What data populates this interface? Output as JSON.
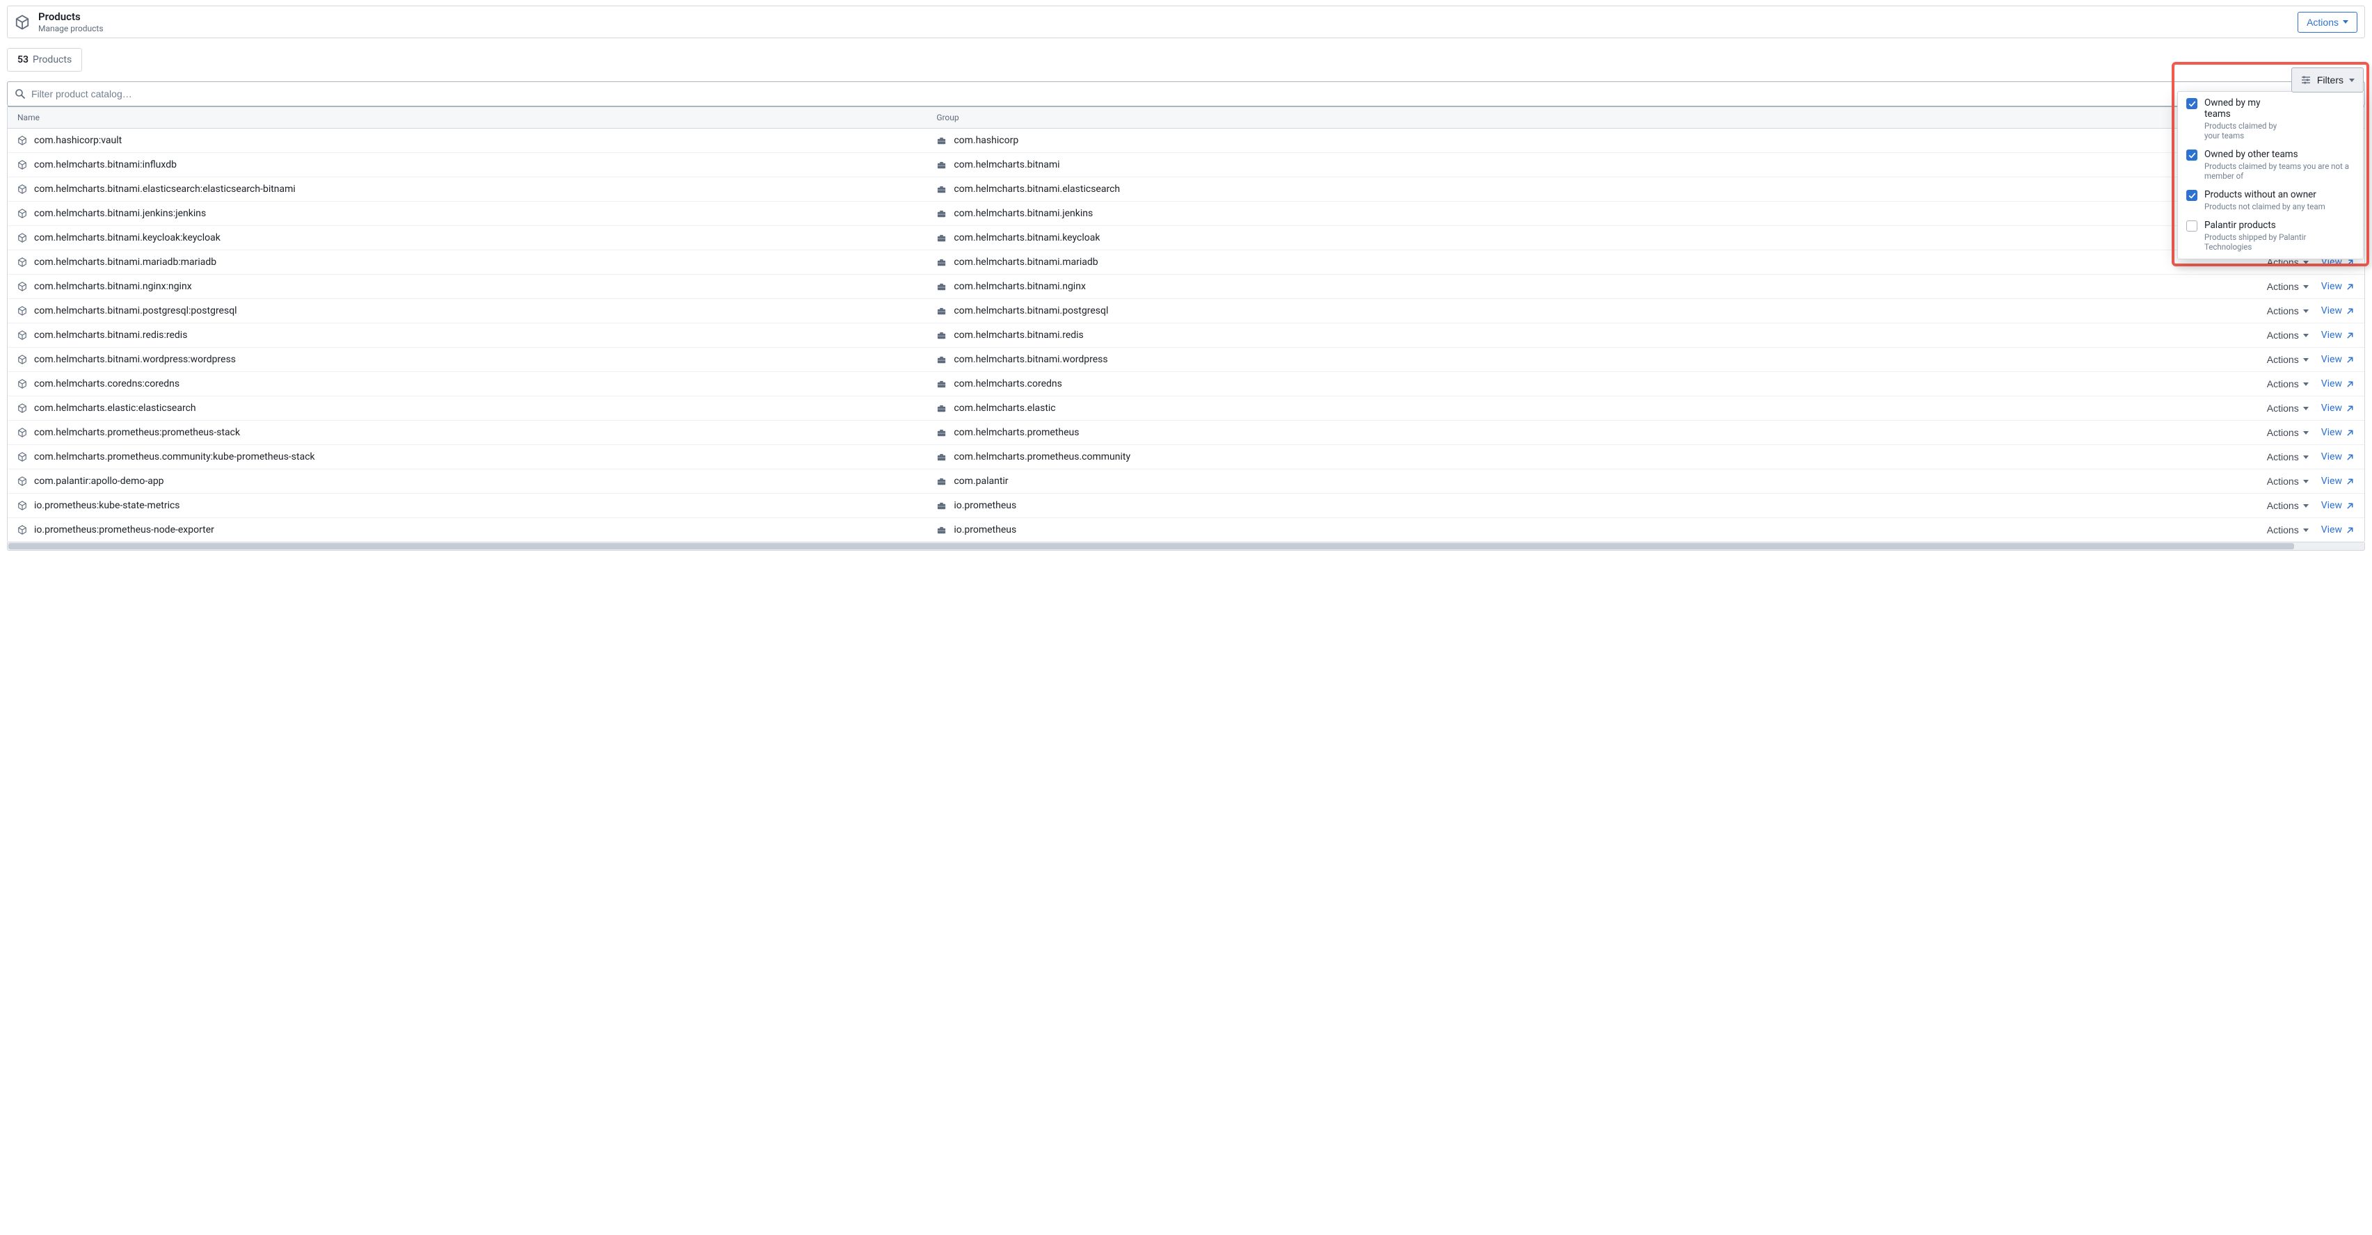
{
  "header": {
    "title": "Products",
    "subtitle": "Manage products",
    "actions_label": "Actions"
  },
  "tab": {
    "count": "53",
    "label": "Products"
  },
  "search": {
    "placeholder": "Filter product catalog…"
  },
  "filters_button": "Filters",
  "columns": {
    "name": "Name",
    "group": "Group"
  },
  "row_action_label": "Actions",
  "view_label": "View",
  "filters": [
    {
      "title": "Owned by my teams",
      "desc": "Products claimed by your teams",
      "checked": true
    },
    {
      "title": "Owned by other teams",
      "desc": "Products claimed by teams you are not a member of",
      "checked": true
    },
    {
      "title": "Products without an owner",
      "desc": "Products not claimed by any team",
      "checked": true
    },
    {
      "title": "Palantir products",
      "desc": "Products shipped by Palantir Technologies",
      "checked": false
    }
  ],
  "rows": [
    {
      "name": "com.hashicorp:vault",
      "group": "com.hashicorp"
    },
    {
      "name": "com.helmcharts.bitnami:influxdb",
      "group": "com.helmcharts.bitnami"
    },
    {
      "name": "com.helmcharts.bitnami.elasticsearch:elasticsearch-bitnami",
      "group": "com.helmcharts.bitnami.elasticsearch"
    },
    {
      "name": "com.helmcharts.bitnami.jenkins:jenkins",
      "group": "com.helmcharts.bitnami.jenkins"
    },
    {
      "name": "com.helmcharts.bitnami.keycloak:keycloak",
      "group": "com.helmcharts.bitnami.keycloak"
    },
    {
      "name": "com.helmcharts.bitnami.mariadb:mariadb",
      "group": "com.helmcharts.bitnami.mariadb"
    },
    {
      "name": "com.helmcharts.bitnami.nginx:nginx",
      "group": "com.helmcharts.bitnami.nginx"
    },
    {
      "name": "com.helmcharts.bitnami.postgresql:postgresql",
      "group": "com.helmcharts.bitnami.postgresql"
    },
    {
      "name": "com.helmcharts.bitnami.redis:redis",
      "group": "com.helmcharts.bitnami.redis"
    },
    {
      "name": "com.helmcharts.bitnami.wordpress:wordpress",
      "group": "com.helmcharts.bitnami.wordpress"
    },
    {
      "name": "com.helmcharts.coredns:coredns",
      "group": "com.helmcharts.coredns"
    },
    {
      "name": "com.helmcharts.elastic:elasticsearch",
      "group": "com.helmcharts.elastic"
    },
    {
      "name": "com.helmcharts.prometheus:prometheus-stack",
      "group": "com.helmcharts.prometheus"
    },
    {
      "name": "com.helmcharts.prometheus.community:kube-prometheus-stack",
      "group": "com.helmcharts.prometheus.community"
    },
    {
      "name": "com.palantir:apollo-demo-app",
      "group": "com.palantir"
    },
    {
      "name": "io.prometheus:kube-state-metrics",
      "group": "io.prometheus"
    },
    {
      "name": "io.prometheus:prometheus-node-exporter",
      "group": "io.prometheus"
    }
  ]
}
